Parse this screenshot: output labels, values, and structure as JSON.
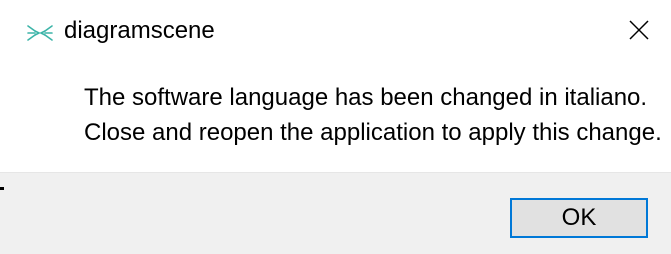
{
  "window": {
    "title": "diagramscene",
    "app_icon": "diagramscene-app-icon",
    "close_icon": "close-icon"
  },
  "message": {
    "line1": "The software language has been changed in italiano.",
    "line2": "Close and reopen the application to apply this change."
  },
  "buttons": {
    "ok_label": "OK"
  },
  "colors": {
    "accent": "#0078d7",
    "footer_bg": "#f0f0f0",
    "button_bg": "#e1e1e1",
    "icon": "#3cb4a8"
  }
}
